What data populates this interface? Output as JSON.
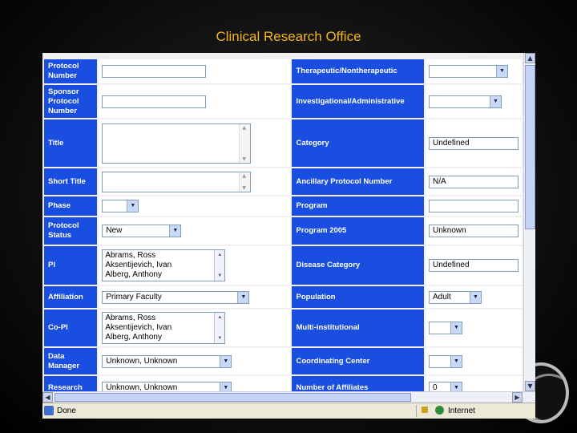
{
  "slide": {
    "title": "Clinical Research Office"
  },
  "status": {
    "text": "Done",
    "zone": "Internet"
  },
  "rows": [
    {
      "left": {
        "label": "Protocol Number",
        "value": ""
      },
      "right": {
        "label": "Therapeutic/Nontherapeutic",
        "value": ""
      }
    },
    {
      "left": {
        "label": "Sponsor Protocol Number",
        "value": ""
      },
      "right": {
        "label": "Investigational/Administrative",
        "value": ""
      }
    },
    {
      "left": {
        "label": "Title",
        "value": ""
      },
      "right": {
        "label": "Category",
        "value": "Undefined"
      }
    },
    {
      "left": {
        "label": "Short Title",
        "value": ""
      },
      "right": {
        "label": "Ancillary Protocol Number",
        "value": "N/A"
      }
    },
    {
      "left": {
        "label": "Phase",
        "value": ""
      },
      "right": {
        "label": "Program",
        "value": ""
      }
    },
    {
      "left": {
        "label": "Protocol Status",
        "value": "New"
      },
      "right": {
        "label": "Program 2005",
        "value": "Unknown"
      }
    },
    {
      "left": {
        "label": "PI",
        "options": [
          "Abrams, Ross",
          "Aksentijevich, Ivan",
          "Alberg, Anthony"
        ]
      },
      "right": {
        "label": "Disease Category",
        "value": "Undefined"
      }
    },
    {
      "left": {
        "label": "Affiliation",
        "value": "Primary Faculty"
      },
      "right": {
        "label": "Population",
        "value": "Adult"
      }
    },
    {
      "left": {
        "label": "Co-PI",
        "options": [
          "Abrams, Ross",
          "Aksentijevich, Ivan",
          "Alberg, Anthony"
        ]
      },
      "right": {
        "label": "Multi-institutional",
        "value": ""
      }
    },
    {
      "left": {
        "label": "Data Manager",
        "value": "Unknown, Unknown"
      },
      "right": {
        "label": "Coordinating Center",
        "value": ""
      }
    },
    {
      "left": {
        "label": "Research",
        "value": "Unknown, Unknown"
      },
      "right": {
        "label": "Number of Affiliates",
        "value": "0"
      }
    }
  ]
}
